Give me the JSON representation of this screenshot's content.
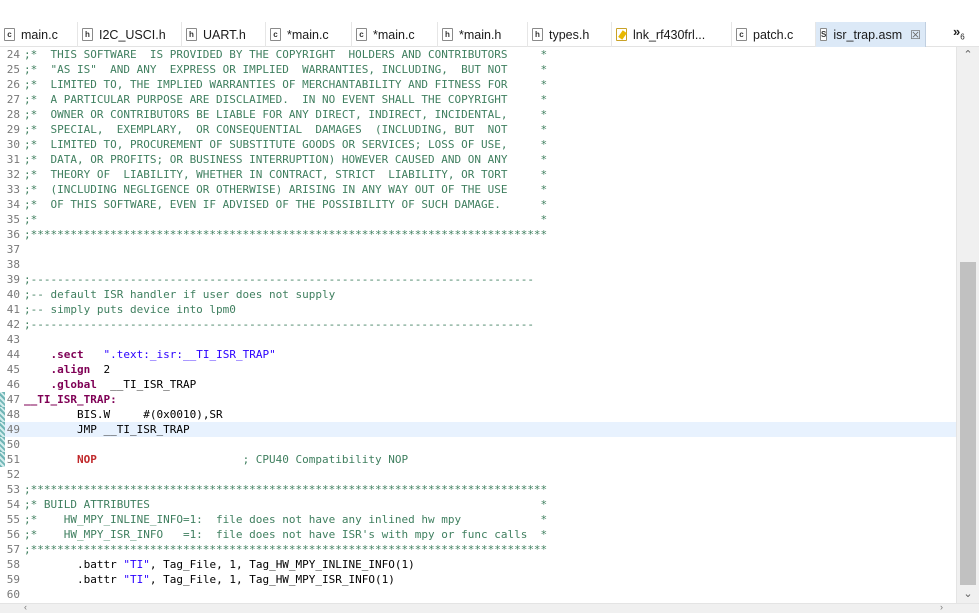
{
  "tabs": [
    {
      "label": "main.c",
      "icon": "c-file-icon",
      "glyph": "c"
    },
    {
      "label": "I2C_USCI.h",
      "icon": "h-file-icon",
      "glyph": "h"
    },
    {
      "label": "UART.h",
      "icon": "h-file-icon",
      "glyph": "h"
    },
    {
      "label": "*main.c",
      "icon": "c-file-icon",
      "glyph": "c"
    },
    {
      "label": "*main.c",
      "icon": "c-file-icon",
      "glyph": "c"
    },
    {
      "label": "*main.h",
      "icon": "h-file-icon",
      "glyph": "h"
    },
    {
      "label": "types.h",
      "icon": "h-file-icon",
      "glyph": "h"
    },
    {
      "label": "lnk_rf430frl...",
      "icon": "linker-file-icon",
      "glyph": ""
    },
    {
      "label": "patch.c",
      "icon": "c-file-icon",
      "glyph": "c"
    },
    {
      "label": "isr_trap.asm",
      "icon": "asm-file-icon",
      "glyph": "S",
      "active": true,
      "close": "☒"
    }
  ],
  "overflow": {
    "symbol": "»",
    "count": "6"
  },
  "colors": {
    "comment": "#3f7f5f",
    "directive": "#7f0055",
    "string": "#2a00ff",
    "nop": "#c0282a",
    "current_line": "#e8f2fe",
    "active_tab": "#dce9f7"
  },
  "lines": [
    {
      "n": "24",
      "t": "cmt",
      "text": ";*  THIS SOFTWARE  IS PROVIDED BY THE COPYRIGHT  HOLDERS AND CONTRIBUTORS     *"
    },
    {
      "n": "25",
      "t": "cmt",
      "text": ";*  \"AS IS\"  AND ANY  EXPRESS OR IMPLIED  WARRANTIES, INCLUDING,  BUT NOT     *"
    },
    {
      "n": "26",
      "t": "cmt",
      "text": ";*  LIMITED TO, THE IMPLIED WARRANTIES OF MERCHANTABILITY AND FITNESS FOR     *"
    },
    {
      "n": "27",
      "t": "cmt",
      "text": ";*  A PARTICULAR PURPOSE ARE DISCLAIMED.  IN NO EVENT SHALL THE COPYRIGHT     *"
    },
    {
      "n": "28",
      "t": "cmt",
      "text": ";*  OWNER OR CONTRIBUTORS BE LIABLE FOR ANY DIRECT, INDIRECT, INCIDENTAL,     *"
    },
    {
      "n": "29",
      "t": "cmt",
      "text": ";*  SPECIAL,  EXEMPLARY,  OR CONSEQUENTIAL  DAMAGES  (INCLUDING, BUT  NOT     *"
    },
    {
      "n": "30",
      "t": "cmt",
      "text": ";*  LIMITED TO, PROCUREMENT OF SUBSTITUTE GOODS OR SERVICES; LOSS OF USE,     *"
    },
    {
      "n": "31",
      "t": "cmt",
      "text": ";*  DATA, OR PROFITS; OR BUSINESS INTERRUPTION) HOWEVER CAUSED AND ON ANY     *"
    },
    {
      "n": "32",
      "t": "cmt",
      "text": ";*  THEORY OF  LIABILITY, WHETHER IN CONTRACT, STRICT  LIABILITY, OR TORT     *"
    },
    {
      "n": "33",
      "t": "cmt",
      "text": ";*  (INCLUDING NEGLIGENCE OR OTHERWISE) ARISING IN ANY WAY OUT OF THE USE     *"
    },
    {
      "n": "34",
      "t": "cmt",
      "text": ";*  OF THIS SOFTWARE, EVEN IF ADVISED OF THE POSSIBILITY OF SUCH DAMAGE.      *"
    },
    {
      "n": "35",
      "t": "cmt",
      "text": ";*                                                                            *"
    },
    {
      "n": "36",
      "t": "cmt",
      "text": ";******************************************************************************"
    },
    {
      "n": "37",
      "t": "plain",
      "text": ""
    },
    {
      "n": "38",
      "t": "plain",
      "text": ""
    },
    {
      "n": "39",
      "t": "cmt",
      "text": ";----------------------------------------------------------------------------"
    },
    {
      "n": "40",
      "t": "cmt",
      "text": ";-- default ISR handler if user does not supply"
    },
    {
      "n": "41",
      "t": "cmt",
      "text": ";-- simply puts device into lpm0"
    },
    {
      "n": "42",
      "t": "cmt",
      "text": ";----------------------------------------------------------------------------"
    },
    {
      "n": "43",
      "t": "plain",
      "text": ""
    },
    {
      "n": "44",
      "t": "dirstr",
      "dir": ".sect",
      "arg": "\".text:_isr:__TI_ISR_TRAP\""
    },
    {
      "n": "45",
      "t": "dirnum",
      "dir": ".align",
      "arg": "2"
    },
    {
      "n": "46",
      "t": "dirnum",
      "dir": ".global",
      "arg": "__TI_ISR_TRAP"
    },
    {
      "n": "47",
      "t": "label",
      "text": "__TI_ISR_TRAP:",
      "mark": true
    },
    {
      "n": "48",
      "t": "instr",
      "text": "BIS.W     #(0x0010),SR",
      "mark": true
    },
    {
      "n": "49",
      "t": "instr",
      "text": "JMP __TI_ISR_TRAP",
      "mark": true,
      "current": true
    },
    {
      "n": "50",
      "t": "plain",
      "text": "",
      "mark": true
    },
    {
      "n": "51",
      "t": "nop",
      "op": "NOP",
      "comment": "; CPU40 Compatibility NOP",
      "mark": true
    },
    {
      "n": "52",
      "t": "plain",
      "text": ""
    },
    {
      "n": "53",
      "t": "cmt",
      "text": ";******************************************************************************"
    },
    {
      "n": "54",
      "t": "cmt",
      "text": ";* BUILD ATTRIBUTES                                                           *"
    },
    {
      "n": "55",
      "t": "cmt",
      "text": ";*    HW_MPY_INLINE_INFO=1:  file does not have any inlined hw mpy            *"
    },
    {
      "n": "56",
      "t": "cmt",
      "text": ";*    HW_MPY_ISR_INFO   =1:  file does not have ISR's with mpy or func calls  *"
    },
    {
      "n": "57",
      "t": "cmt",
      "text": ";******************************************************************************"
    },
    {
      "n": "58",
      "t": "battr",
      "dir": ".battr",
      "str": "\"TI\"",
      "rest": ", Tag_File, 1, Tag_HW_MPY_INLINE_INFO(1)"
    },
    {
      "n": "59",
      "t": "battr",
      "dir": ".battr",
      "str": "\"TI\"",
      "rest": ", Tag_File, 1, Tag_HW_MPY_ISR_INFO(1)"
    },
    {
      "n": "60",
      "t": "plain",
      "text": ""
    }
  ]
}
